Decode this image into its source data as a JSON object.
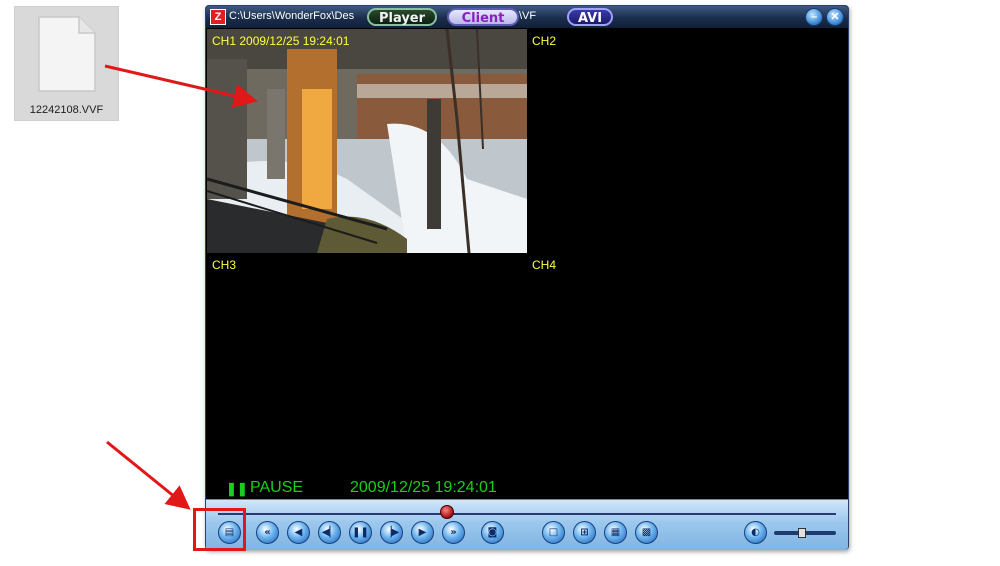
{
  "desktop": {
    "file_name": "12242108.VVF"
  },
  "window": {
    "title_path_start": "C:\\Users\\WonderFox\\Des",
    "title_path_end": "\\VF",
    "tabs": [
      {
        "label": "Player"
      },
      {
        "label": "Client"
      },
      {
        "label": "AVI"
      }
    ],
    "minimize_icon": "minimize-icon",
    "close_icon": "close-icon"
  },
  "channels": [
    {
      "label": "CH1 2009/12/25 19:24:01"
    },
    {
      "label": "CH2"
    },
    {
      "label": "CH3"
    },
    {
      "label": "CH4"
    }
  ],
  "status": {
    "state_icon": "pause-icon",
    "state": "PAUSE",
    "timestamp": "2009/12/25 19:24:01"
  },
  "playback": {
    "progress_fraction": 0.37,
    "volume_fraction": 0.45
  },
  "controls": [
    {
      "name": "open-file-button",
      "icon": "open-folder-icon",
      "glyph": "▤"
    },
    {
      "name": "fast-rewind-button",
      "icon": "fast-rewind-icon",
      "glyph": "«"
    },
    {
      "name": "previous-button",
      "icon": "previous-icon",
      "glyph": "◀"
    },
    {
      "name": "step-back-button",
      "icon": "step-back-icon",
      "glyph": "◀▏"
    },
    {
      "name": "pause-button",
      "icon": "pause-icon",
      "glyph": "❚❚"
    },
    {
      "name": "step-forward-button",
      "icon": "step-forward-icon",
      "glyph": "▕▶"
    },
    {
      "name": "play-button",
      "icon": "play-icon",
      "glyph": "▶"
    },
    {
      "name": "fast-forward-button",
      "icon": "fast-forward-icon",
      "glyph": "»"
    },
    {
      "name": "snapshot-button",
      "icon": "camera-icon",
      "glyph": "◙"
    },
    {
      "name": "single-view-button",
      "icon": "single-screen-icon",
      "glyph": "□"
    },
    {
      "name": "quad-view-button",
      "icon": "quad-screen-icon",
      "glyph": "⊞"
    },
    {
      "name": "nine-view-button",
      "icon": "nine-screen-icon",
      "glyph": "▦"
    },
    {
      "name": "sixteen-view-button",
      "icon": "sixteen-screen-icon",
      "glyph": "▩"
    },
    {
      "name": "volume-button",
      "icon": "speaker-icon",
      "glyph": "◐"
    }
  ],
  "annotation_color": "#e01818"
}
